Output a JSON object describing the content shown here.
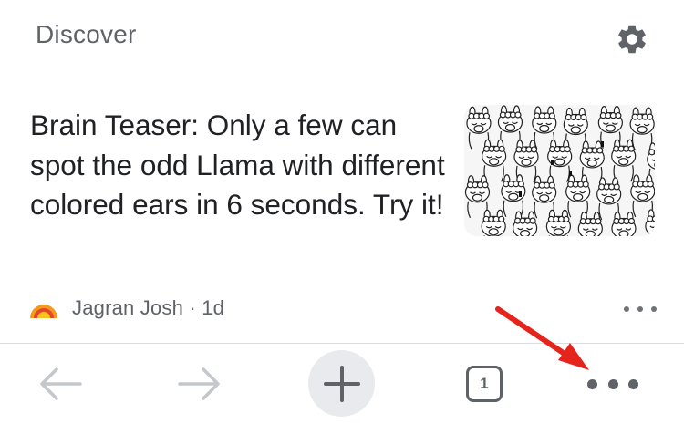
{
  "header": {
    "title": "Discover",
    "settings_icon": "gear-icon"
  },
  "card": {
    "headline": "Brain Teaser: Only a few can spot the odd Llama with different colored ears in 6 seconds. Try it!",
    "thumbnail_alt": "Black and white llama illustration brain teaser",
    "source": "Jagran Josh · 1d",
    "source_logo_icon": "jagran-josh-logo",
    "menu_icon": "more-horizontal-icon"
  },
  "toolbar": {
    "back_icon": "back-arrow-icon",
    "forward_icon": "forward-arrow-icon",
    "new_tab_icon": "plus-icon",
    "tab_count": "1",
    "more_icon": "more-horizontal-icon"
  },
  "annotation": {
    "arrow_color": "#e5241b"
  },
  "colors": {
    "text_primary": "#202124",
    "text_secondary": "#5f6368",
    "icon_disabled": "#c4c7cb",
    "new_tab_bg": "#e8eaed",
    "divider": "#dadce0"
  }
}
